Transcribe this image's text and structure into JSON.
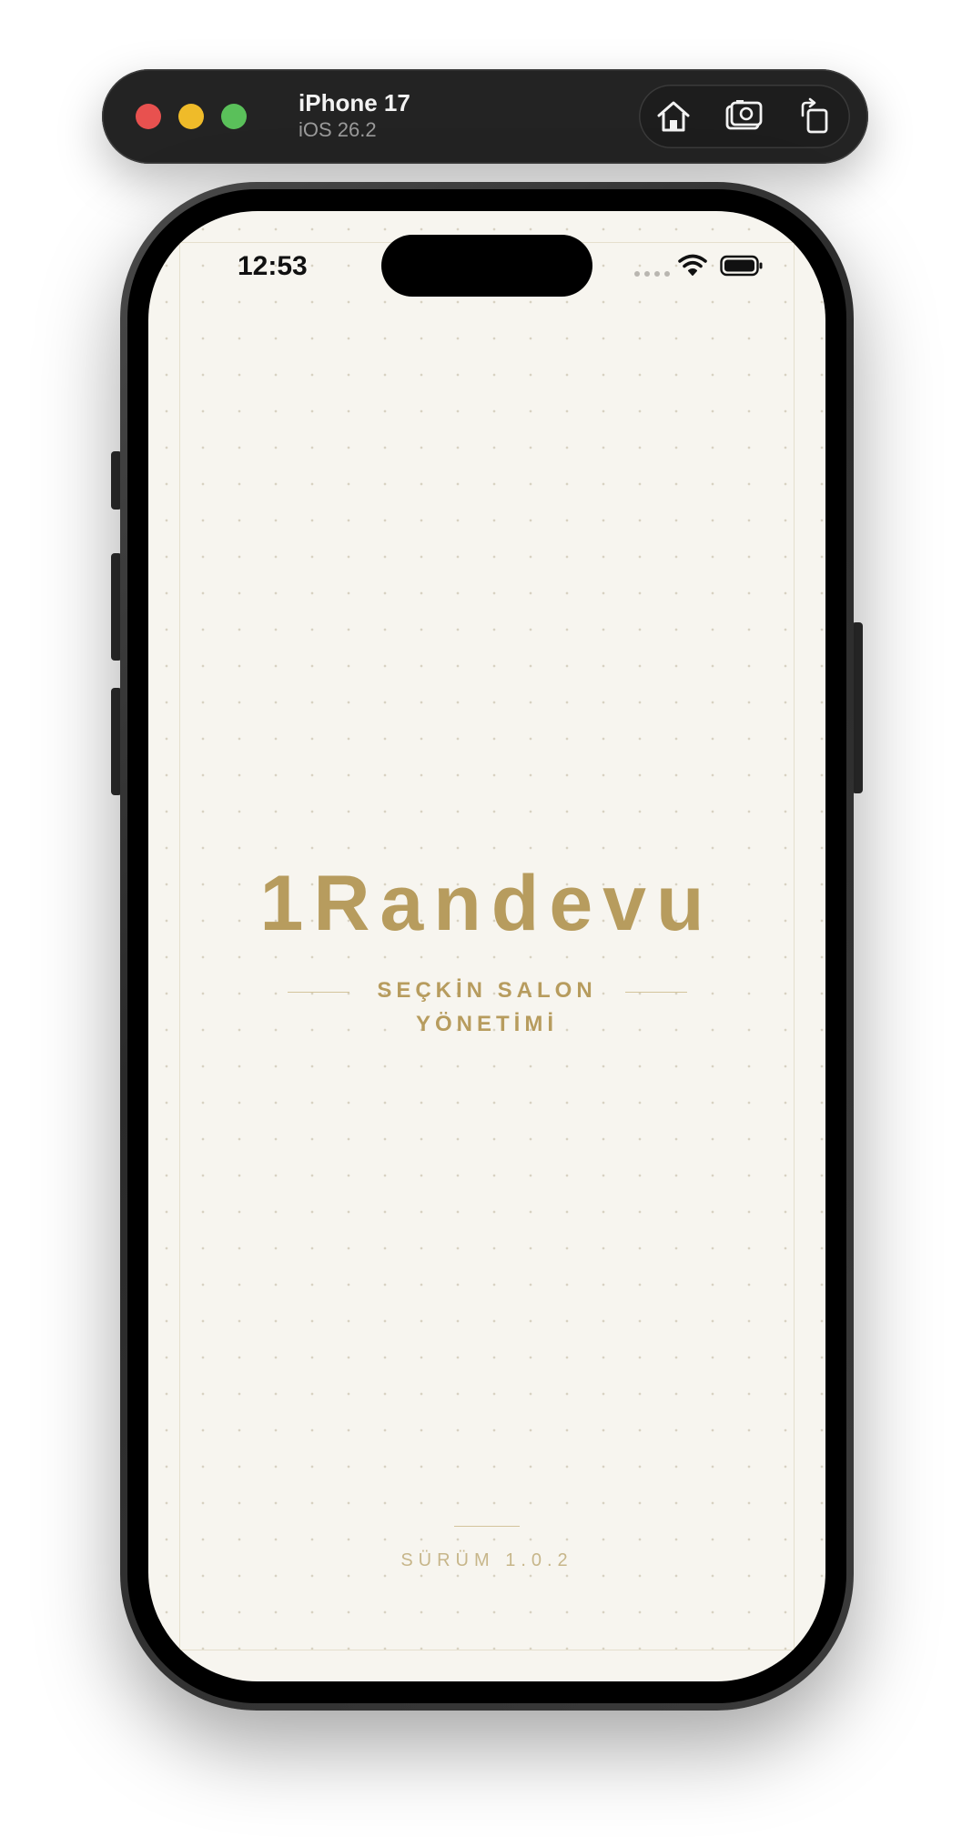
{
  "simulator": {
    "device_name": "iPhone 17",
    "os_version": "iOS 26.2",
    "toolbar_buttons": [
      "home-icon",
      "screenshot-icon",
      "rotate-icon"
    ]
  },
  "status_bar": {
    "time": "12:53",
    "wifi": "wifi-icon",
    "battery": "battery-icon"
  },
  "app": {
    "title": "1Randevu",
    "tagline_line1": "SEÇKİN SALON",
    "tagline_line2": "YÖNETİMİ",
    "version": "SÜRÜM 1.0.2"
  },
  "colors": {
    "accent_gold": "#b79c5e",
    "background": "#f7f5ef"
  }
}
